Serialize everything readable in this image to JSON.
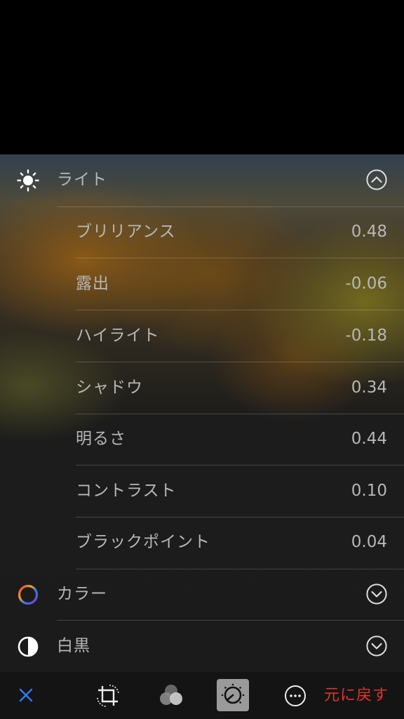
{
  "photo": {
    "description_color": "#000000"
  },
  "sections": {
    "light": {
      "label": "ライト",
      "icon": "sun-icon",
      "expanded": true,
      "items": [
        {
          "label": "ブリリアンス",
          "value": "0.48"
        },
        {
          "label": "露出",
          "value": "-0.06"
        },
        {
          "label": "ハイライト",
          "value": "-0.18"
        },
        {
          "label": "シャドウ",
          "value": "0.34"
        },
        {
          "label": "明るさ",
          "value": "0.44"
        },
        {
          "label": "コントラスト",
          "value": "0.10"
        },
        {
          "label": "ブラックポイント",
          "value": "0.04"
        }
      ]
    },
    "color": {
      "label": "カラー",
      "icon": "color-ring-icon",
      "expanded": false
    },
    "bw": {
      "label": "白黒",
      "icon": "half-circle-icon",
      "expanded": false
    }
  },
  "toolbar": {
    "cancel_icon": "close-icon",
    "crop_icon": "crop-rotate-icon",
    "filters_icon": "filters-icon",
    "adjust_icon": "adjust-dial-icon",
    "more_icon": "more-icon",
    "revert_label": "元に戻す"
  },
  "colors": {
    "accent_blue": "#2f7cf6",
    "revert_red": "#e0342a",
    "text": "#b7b7b7"
  }
}
